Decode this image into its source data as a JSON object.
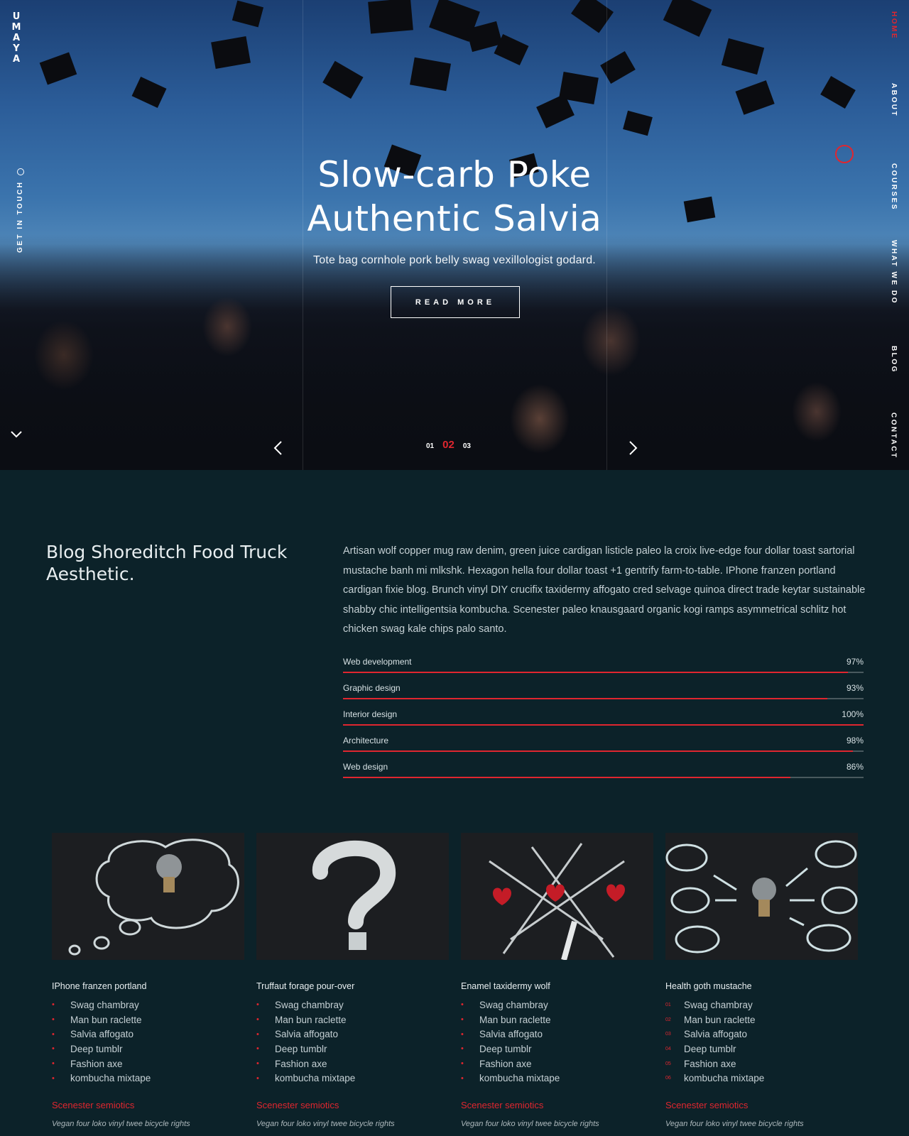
{
  "brand": {
    "logo_text": "UMAYA"
  },
  "colors": {
    "accent": "#e0262f",
    "background": "#0c2229",
    "text": "#d7e1e4"
  },
  "left_rail": {
    "get_in_touch": "GET IN TOUCH",
    "phone_icon": "phone-icon",
    "scroll_icon": "chevron-down-icon"
  },
  "nav": {
    "items": [
      {
        "label": "HOME",
        "active": true
      },
      {
        "label": "ABOUT",
        "active": false
      },
      {
        "label": "COURSES",
        "active": false
      },
      {
        "label": "WHAT WE DO",
        "active": false
      },
      {
        "label": "BLOG",
        "active": false
      },
      {
        "label": "CONTACT",
        "active": false
      }
    ]
  },
  "hero": {
    "title_line1": "Slow-carb Poke",
    "title_line2": "Authentic Salvia",
    "subtitle": "Tote bag cornhole pork belly swag vexillologist godard.",
    "cta": "READ MORE",
    "slides": [
      "01",
      "02",
      "03"
    ],
    "active_slide": "02",
    "prev_icon": "chevron-left-icon",
    "next_icon": "chevron-right-icon"
  },
  "about": {
    "title": "Blog Shoreditch Food Truck Aesthetic.",
    "text": "Artisan wolf copper mug raw denim, green juice cardigan listicle paleo la croix live-edge four dollar toast sartorial mustache banh mi mlkshk. Hexagon hella four dollar toast +1 gentrify farm-to-table. IPhone franzen portland cardigan fixie blog. Brunch vinyl DIY crucifix taxidermy affogato cred selvage quinoa direct trade keytar sustainable shabby chic intelligentsia kombucha. Scenester paleo knausgaard organic kogi ramps asymmetrical schlitz hot chicken swag kale chips palo santo.",
    "skills": [
      {
        "label": "Web development",
        "value_text": "97%",
        "value": 97
      },
      {
        "label": "Graphic design",
        "value_text": "93%",
        "value": 93
      },
      {
        "label": "Interior design",
        "value_text": "100%",
        "value": 100
      },
      {
        "label": "Architecture",
        "value_text": "98%",
        "value": 98
      },
      {
        "label": "Web design",
        "value_text": "86%",
        "value": 86
      }
    ]
  },
  "cards": [
    {
      "image": "lightbulb-thought-cloud-image",
      "title": "IPhone franzen portland",
      "bullet_style": "dot",
      "items": [
        "Swag chambray",
        "Man bun raclette",
        "Salvia affogato",
        "Deep tumblr",
        "Fashion axe",
        "kombucha mixtape"
      ],
      "subtitle": "Scenester semiotics",
      "note": "Vegan four loko vinyl twee bicycle rights"
    },
    {
      "image": "question-mark-image",
      "title": "Truffaut forage pour-over",
      "bullet_style": "dot",
      "items": [
        "Swag chambray",
        "Man bun raclette",
        "Salvia affogato",
        "Deep tumblr",
        "Fashion axe",
        "kombucha mixtape"
      ],
      "subtitle": "Scenester semiotics",
      "note": "Vegan four loko vinyl twee bicycle rights"
    },
    {
      "image": "tic-tac-toe-hearts-image",
      "title": "Enamel taxidermy wolf",
      "bullet_style": "dot",
      "items": [
        "Swag chambray",
        "Man bun raclette",
        "Salvia affogato",
        "Deep tumblr",
        "Fashion axe",
        "kombucha mixtape"
      ],
      "subtitle": "Scenester semiotics",
      "note": "Vegan four loko vinyl twee bicycle rights"
    },
    {
      "image": "lightbulb-mindmap-image",
      "title": "Health goth mustache",
      "bullet_style": "number",
      "numbers": [
        "01",
        "02",
        "03",
        "04",
        "05",
        "06"
      ],
      "items": [
        "Swag chambray",
        "Man bun raclette",
        "Salvia affogato",
        "Deep tumblr",
        "Fashion axe",
        "kombucha mixtape"
      ],
      "subtitle": "Scenester semiotics",
      "note": "Vegan four loko vinyl twee bicycle rights"
    }
  ]
}
